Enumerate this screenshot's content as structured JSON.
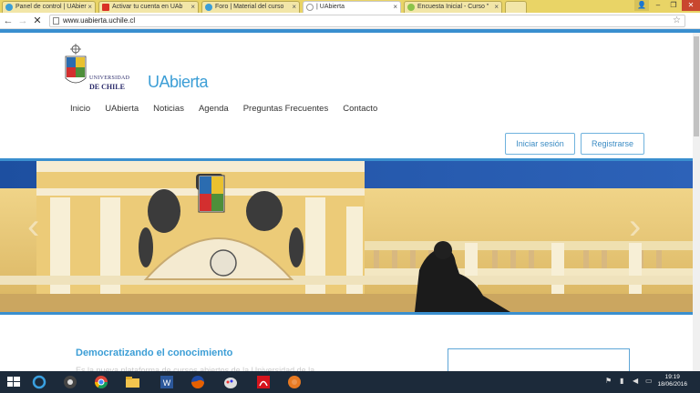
{
  "browser": {
    "tabs": [
      {
        "label": "Panel de control | UAbier",
        "icon": "uabierta-favicon",
        "active": false
      },
      {
        "label": "Activar tu cuenta en UAb",
        "icon": "gmail-favicon",
        "active": false
      },
      {
        "label": "Foro | Material del curso",
        "icon": "uabierta-favicon",
        "active": false
      },
      {
        "label": "| UAbierta",
        "icon": "loading-favicon",
        "active": true
      },
      {
        "label": "Encuesta Inicial - Curso \"",
        "icon": "survey-favicon",
        "active": false
      }
    ],
    "url": "www.uabierta.uchile.cl",
    "window_controls": {
      "user": "👤",
      "minimize": "–",
      "maximize": "❐",
      "close": "✕"
    },
    "nav": {
      "back": "←",
      "forward": "→",
      "stop": "✕"
    },
    "star": "☆"
  },
  "site": {
    "university_line1": "UNIVERSIDAD",
    "university_line2": "DE CHILE",
    "brand": "UAbierta",
    "menu": [
      "Inicio",
      "UAbierta",
      "Noticias",
      "Agenda",
      "Preguntas Frecuentes",
      "Contacto"
    ],
    "login_label": "Iniciar sesión",
    "register_label": "Registrarse",
    "slider": {
      "prev": "‹",
      "next": "›"
    },
    "section_title": "Democratizando el conocimiento",
    "section_text": "Es la nueva plataforma de cursos abiertos de la Universidad de la..."
  },
  "taskbar": {
    "time": "19:19",
    "date": "18/06/2016",
    "apps": [
      "start-icon",
      "ie-icon",
      "media-icon",
      "chrome-icon",
      "folder-icon",
      "word-icon",
      "firefox-icon",
      "paint-icon",
      "acrobat-icon",
      "game-icon"
    ]
  },
  "colors": {
    "accent": "#3a8fcf",
    "tabbar": "#e9d466",
    "taskbar": "#1c2a3a"
  }
}
